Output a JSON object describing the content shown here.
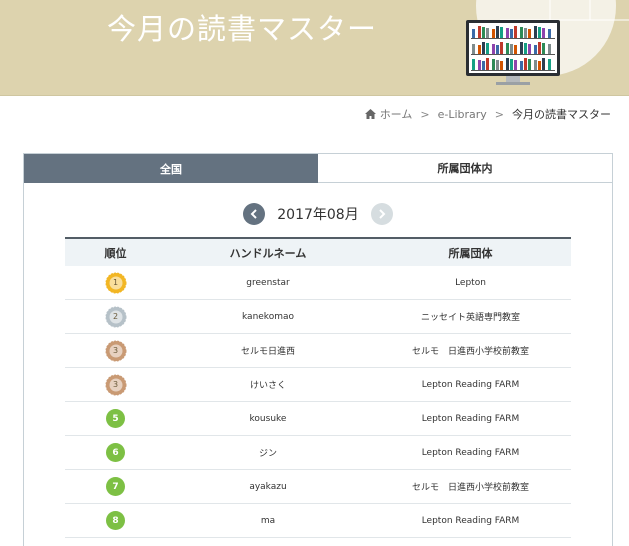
{
  "banner": {
    "title": "今月の読書マスター"
  },
  "breadcrumb": {
    "home": "ホーム",
    "library": "e-Library",
    "current": "今月の読書マスター",
    "separator": ">"
  },
  "tabs": [
    {
      "label": "全国",
      "active": true
    },
    {
      "label": "所属団体内",
      "active": false
    }
  ],
  "month_nav": {
    "label": "2017年08月"
  },
  "table": {
    "headers": {
      "rank": "順位",
      "name": "ハンドルネーム",
      "org": "所属団体"
    },
    "rows": [
      {
        "rank": "1",
        "badge": "gold-medal",
        "name": "greenstar",
        "org": "Lepton"
      },
      {
        "rank": "2",
        "badge": "silver-medal",
        "name": "kanekomao",
        "org": "ニッセイト英語専門教室"
      },
      {
        "rank": "3",
        "badge": "bronze-medal",
        "name": "セルモ日進西",
        "org": "セルモ　日進西小学校前教室"
      },
      {
        "rank": "3",
        "badge": "bronze-medal",
        "name": "けいさく",
        "org": "Lepton Reading FARM"
      },
      {
        "rank": "5",
        "badge": "green-circle",
        "name": "kousuke",
        "org": "Lepton Reading FARM"
      },
      {
        "rank": "6",
        "badge": "green-circle",
        "name": "ジン",
        "org": "Lepton Reading FARM"
      },
      {
        "rank": "7",
        "badge": "green-circle",
        "name": "ayakazu",
        "org": "セルモ　日進西小学校前教室"
      },
      {
        "rank": "8",
        "badge": "green-circle",
        "name": "ma",
        "org": "Lepton Reading FARM"
      }
    ]
  },
  "colors": {
    "banner_bg": "#ddd3ae",
    "tab_active": "#647280",
    "gold": "#f2b624",
    "silver": "#b6c1c8",
    "bronze": "#c99a74",
    "green": "#7dc044"
  }
}
